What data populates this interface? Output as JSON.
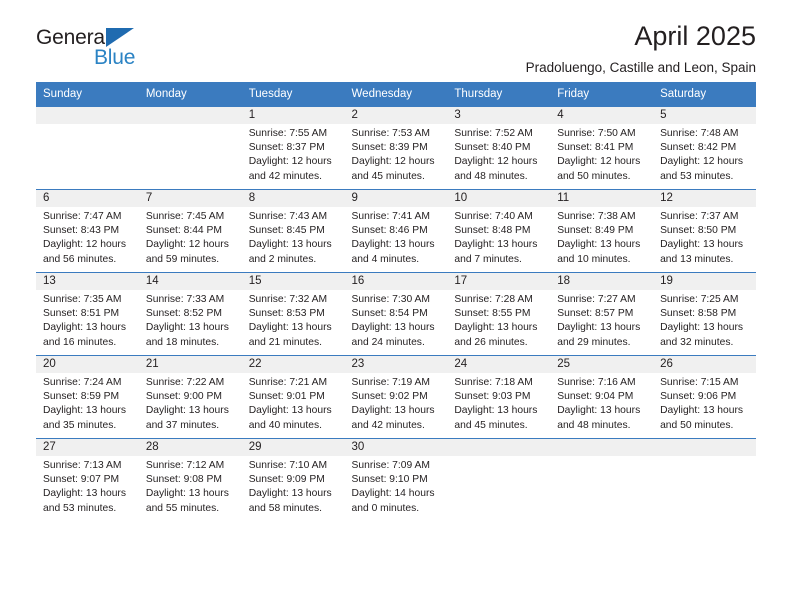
{
  "brand": {
    "name_part1": "General",
    "name_part2": "Blue",
    "triangle_icon": "triangle-icon",
    "accent_color": "#2b83c4",
    "header_color": "#3b7bbf"
  },
  "header": {
    "title": "April 2025",
    "subtitle": "Pradoluengo, Castille and Leon, Spain"
  },
  "calendar": {
    "weekday_headers": [
      "Sunday",
      "Monday",
      "Tuesday",
      "Wednesday",
      "Thursday",
      "Friday",
      "Saturday"
    ],
    "weeks": [
      [
        {
          "day": "",
          "lines": [
            "",
            "",
            ""
          ]
        },
        {
          "day": "",
          "lines": [
            "",
            "",
            ""
          ]
        },
        {
          "day": "1",
          "lines": [
            "Sunrise: 7:55 AM",
            "Sunset: 8:37 PM",
            "Daylight: 12 hours and 42 minutes."
          ]
        },
        {
          "day": "2",
          "lines": [
            "Sunrise: 7:53 AM",
            "Sunset: 8:39 PM",
            "Daylight: 12 hours and 45 minutes."
          ]
        },
        {
          "day": "3",
          "lines": [
            "Sunrise: 7:52 AM",
            "Sunset: 8:40 PM",
            "Daylight: 12 hours and 48 minutes."
          ]
        },
        {
          "day": "4",
          "lines": [
            "Sunrise: 7:50 AM",
            "Sunset: 8:41 PM",
            "Daylight: 12 hours and 50 minutes."
          ]
        },
        {
          "day": "5",
          "lines": [
            "Sunrise: 7:48 AM",
            "Sunset: 8:42 PM",
            "Daylight: 12 hours and 53 minutes."
          ]
        }
      ],
      [
        {
          "day": "6",
          "lines": [
            "Sunrise: 7:47 AM",
            "Sunset: 8:43 PM",
            "Daylight: 12 hours and 56 minutes."
          ]
        },
        {
          "day": "7",
          "lines": [
            "Sunrise: 7:45 AM",
            "Sunset: 8:44 PM",
            "Daylight: 12 hours and 59 minutes."
          ]
        },
        {
          "day": "8",
          "lines": [
            "Sunrise: 7:43 AM",
            "Sunset: 8:45 PM",
            "Daylight: 13 hours and 2 minutes."
          ]
        },
        {
          "day": "9",
          "lines": [
            "Sunrise: 7:41 AM",
            "Sunset: 8:46 PM",
            "Daylight: 13 hours and 4 minutes."
          ]
        },
        {
          "day": "10",
          "lines": [
            "Sunrise: 7:40 AM",
            "Sunset: 8:48 PM",
            "Daylight: 13 hours and 7 minutes."
          ]
        },
        {
          "day": "11",
          "lines": [
            "Sunrise: 7:38 AM",
            "Sunset: 8:49 PM",
            "Daylight: 13 hours and 10 minutes."
          ]
        },
        {
          "day": "12",
          "lines": [
            "Sunrise: 7:37 AM",
            "Sunset: 8:50 PM",
            "Daylight: 13 hours and 13 minutes."
          ]
        }
      ],
      [
        {
          "day": "13",
          "lines": [
            "Sunrise: 7:35 AM",
            "Sunset: 8:51 PM",
            "Daylight: 13 hours and 16 minutes."
          ]
        },
        {
          "day": "14",
          "lines": [
            "Sunrise: 7:33 AM",
            "Sunset: 8:52 PM",
            "Daylight: 13 hours and 18 minutes."
          ]
        },
        {
          "day": "15",
          "lines": [
            "Sunrise: 7:32 AM",
            "Sunset: 8:53 PM",
            "Daylight: 13 hours and 21 minutes."
          ]
        },
        {
          "day": "16",
          "lines": [
            "Sunrise: 7:30 AM",
            "Sunset: 8:54 PM",
            "Daylight: 13 hours and 24 minutes."
          ]
        },
        {
          "day": "17",
          "lines": [
            "Sunrise: 7:28 AM",
            "Sunset: 8:55 PM",
            "Daylight: 13 hours and 26 minutes."
          ]
        },
        {
          "day": "18",
          "lines": [
            "Sunrise: 7:27 AM",
            "Sunset: 8:57 PM",
            "Daylight: 13 hours and 29 minutes."
          ]
        },
        {
          "day": "19",
          "lines": [
            "Sunrise: 7:25 AM",
            "Sunset: 8:58 PM",
            "Daylight: 13 hours and 32 minutes."
          ]
        }
      ],
      [
        {
          "day": "20",
          "lines": [
            "Sunrise: 7:24 AM",
            "Sunset: 8:59 PM",
            "Daylight: 13 hours and 35 minutes."
          ]
        },
        {
          "day": "21",
          "lines": [
            "Sunrise: 7:22 AM",
            "Sunset: 9:00 PM",
            "Daylight: 13 hours and 37 minutes."
          ]
        },
        {
          "day": "22",
          "lines": [
            "Sunrise: 7:21 AM",
            "Sunset: 9:01 PM",
            "Daylight: 13 hours and 40 minutes."
          ]
        },
        {
          "day": "23",
          "lines": [
            "Sunrise: 7:19 AM",
            "Sunset: 9:02 PM",
            "Daylight: 13 hours and 42 minutes."
          ]
        },
        {
          "day": "24",
          "lines": [
            "Sunrise: 7:18 AM",
            "Sunset: 9:03 PM",
            "Daylight: 13 hours and 45 minutes."
          ]
        },
        {
          "day": "25",
          "lines": [
            "Sunrise: 7:16 AM",
            "Sunset: 9:04 PM",
            "Daylight: 13 hours and 48 minutes."
          ]
        },
        {
          "day": "26",
          "lines": [
            "Sunrise: 7:15 AM",
            "Sunset: 9:06 PM",
            "Daylight: 13 hours and 50 minutes."
          ]
        }
      ],
      [
        {
          "day": "27",
          "lines": [
            "Sunrise: 7:13 AM",
            "Sunset: 9:07 PM",
            "Daylight: 13 hours and 53 minutes."
          ]
        },
        {
          "day": "28",
          "lines": [
            "Sunrise: 7:12 AM",
            "Sunset: 9:08 PM",
            "Daylight: 13 hours and 55 minutes."
          ]
        },
        {
          "day": "29",
          "lines": [
            "Sunrise: 7:10 AM",
            "Sunset: 9:09 PM",
            "Daylight: 13 hours and 58 minutes."
          ]
        },
        {
          "day": "30",
          "lines": [
            "Sunrise: 7:09 AM",
            "Sunset: 9:10 PM",
            "Daylight: 14 hours and 0 minutes."
          ]
        },
        {
          "day": "",
          "lines": [
            "",
            "",
            ""
          ]
        },
        {
          "day": "",
          "lines": [
            "",
            "",
            ""
          ]
        },
        {
          "day": "",
          "lines": [
            "",
            "",
            ""
          ]
        }
      ]
    ]
  }
}
